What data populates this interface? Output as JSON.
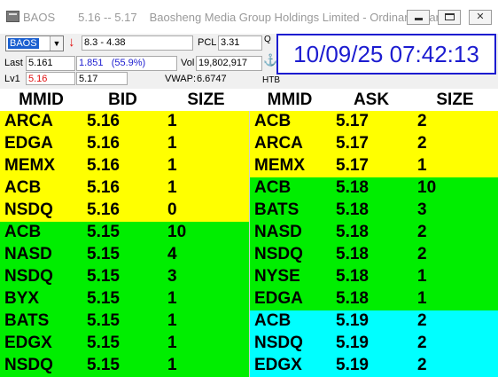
{
  "window": {
    "symbol": "BAOS",
    "range": "5.16 -- 5.17",
    "company": "Baosheng Media Group Holdings Limited - Ordinary shares",
    "controls": {
      "min": "minimize",
      "max": "maximize",
      "close": "✕"
    }
  },
  "panel": {
    "symbol_value": "BAOS",
    "trend_icon": "down-arrow-icon",
    "trend_glyph": "↓",
    "day_range": "8.3 - 4.38",
    "pcl_label": "PCL",
    "pcl_value": "3.31",
    "q_label": "Q",
    "last_label": "Last",
    "last_value": "5.161",
    "change": "1.851",
    "change_pct": "(55.9%)",
    "vol_label": "Vol",
    "vol_value": "19,802,917",
    "anchor_glyph": "⚓",
    "lv1_label": "Lv1",
    "lv1_bid": "5.16",
    "lv1_ask": "5.17",
    "vwap_label": "VWAP:",
    "vwap_value": "6.6747",
    "htb_label": "HTB",
    "clock": "10/09/25 07:42:13",
    "colors": {
      "accent": "#1c1cd0",
      "down": "#e01010",
      "selection": "#1a5fd0"
    }
  },
  "grid": {
    "headers": [
      "MMID",
      "BID",
      "SIZE",
      "MMID",
      "ASK",
      "SIZE"
    ],
    "tier_colors": {
      "yellow": "#ffff00",
      "green": "#00ee00",
      "cyan": "#00ffff"
    },
    "bids": [
      {
        "mmid": "ARCA",
        "price": "5.16",
        "size": "1",
        "tier": "yellow"
      },
      {
        "mmid": "EDGA",
        "price": "5.16",
        "size": "1",
        "tier": "yellow"
      },
      {
        "mmid": "MEMX",
        "price": "5.16",
        "size": "1",
        "tier": "yellow"
      },
      {
        "mmid": "ACB",
        "price": "5.16",
        "size": "1",
        "tier": "yellow"
      },
      {
        "mmid": "NSDQ",
        "price": "5.16",
        "size": "0",
        "tier": "yellow"
      },
      {
        "mmid": "ACB",
        "price": "5.15",
        "size": "10",
        "tier": "green"
      },
      {
        "mmid": "NASD",
        "price": "5.15",
        "size": "4",
        "tier": "green"
      },
      {
        "mmid": "NSDQ",
        "price": "5.15",
        "size": "3",
        "tier": "green"
      },
      {
        "mmid": "BYX",
        "price": "5.15",
        "size": "1",
        "tier": "green"
      },
      {
        "mmid": "BATS",
        "price": "5.15",
        "size": "1",
        "tier": "green"
      },
      {
        "mmid": "EDGX",
        "price": "5.15",
        "size": "1",
        "tier": "green"
      },
      {
        "mmid": "NSDQ",
        "price": "5.15",
        "size": "1",
        "tier": "green"
      }
    ],
    "asks": [
      {
        "mmid": "ACB",
        "price": "5.17",
        "size": "2",
        "tier": "yellow"
      },
      {
        "mmid": "ARCA",
        "price": "5.17",
        "size": "2",
        "tier": "yellow"
      },
      {
        "mmid": "MEMX",
        "price": "5.17",
        "size": "1",
        "tier": "yellow"
      },
      {
        "mmid": "ACB",
        "price": "5.18",
        "size": "10",
        "tier": "green"
      },
      {
        "mmid": "BATS",
        "price": "5.18",
        "size": "3",
        "tier": "green"
      },
      {
        "mmid": "NASD",
        "price": "5.18",
        "size": "2",
        "tier": "green"
      },
      {
        "mmid": "NSDQ",
        "price": "5.18",
        "size": "2",
        "tier": "green"
      },
      {
        "mmid": "NYSE",
        "price": "5.18",
        "size": "1",
        "tier": "green"
      },
      {
        "mmid": "EDGA",
        "price": "5.18",
        "size": "1",
        "tier": "green"
      },
      {
        "mmid": "ACB",
        "price": "5.19",
        "size": "2",
        "tier": "cyan"
      },
      {
        "mmid": "NSDQ",
        "price": "5.19",
        "size": "2",
        "tier": "cyan"
      },
      {
        "mmid": "EDGX",
        "price": "5.19",
        "size": "2",
        "tier": "cyan"
      }
    ]
  }
}
